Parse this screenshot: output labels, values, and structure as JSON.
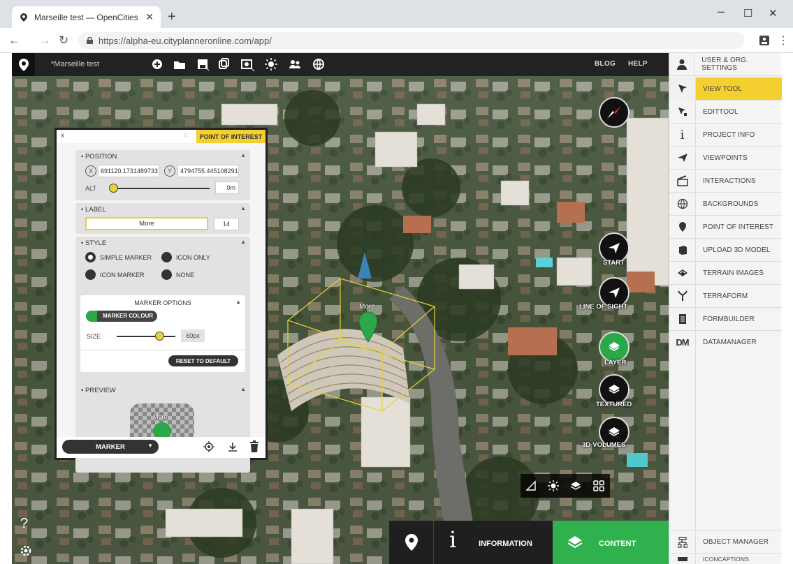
{
  "browser": {
    "tab_title": "Marseille test — OpenCities Plan",
    "url": "https://alpha-eu.cityplanneronline.com/app/"
  },
  "app": {
    "project_name": "*Marseille test",
    "blog": "BLOG",
    "help": "HELP"
  },
  "sidebar": {
    "top_item": "USER & ORG. SETTINGS",
    "items": [
      {
        "label": "VIEW TOOL",
        "icon": "arrow-cursor-icon",
        "active": true
      },
      {
        "label": "EDITTOOL",
        "icon": "edit-cursor-icon"
      },
      {
        "label": "PROJECT INFO",
        "icon": "info-icon"
      },
      {
        "label": "VIEWPOINTS",
        "icon": "paper-plane-icon"
      },
      {
        "label": "INTERACTIONS",
        "icon": "clapperboard-icon"
      },
      {
        "label": "BACKGROUNDS",
        "icon": "globe-icon"
      },
      {
        "label": "POINT OF INTEREST",
        "icon": "map-pin-icon"
      },
      {
        "label": "UPLOAD 3D MODEL",
        "icon": "cube-icon"
      },
      {
        "label": "TERRAIN IMAGES",
        "icon": "terrain-image-icon"
      },
      {
        "label": "TERRAFORM",
        "icon": "terraform-icon"
      },
      {
        "label": "FORMBUILDER",
        "icon": "form-icon"
      },
      {
        "label": "DATAMANAGER",
        "icon": "dm-icon"
      }
    ],
    "object_manager": "OBJECT MANAGER",
    "iconcaptions": "ICONCAPTIONS"
  },
  "poi_panel": {
    "close": "x",
    "title": "POINT OF INTEREST",
    "position": {
      "heading": "• POSITION",
      "x_badge": "X",
      "x_value": "691120.1731489733",
      "y_badge": "Y",
      "y_value": "4794755.445108291",
      "alt_label": "ALT",
      "alt_value": "0m"
    },
    "label": {
      "heading": "• LABEL",
      "text": "More",
      "size": "14"
    },
    "style": {
      "heading": "• STYLE",
      "options": [
        "SIMPLE MARKER",
        "ICON ONLY",
        "ICON MARKER",
        "NONE"
      ],
      "selected": "SIMPLE MARKER"
    },
    "marker_options": {
      "heading": "MARKER OPTIONS",
      "colour_button": "MARKER COLOUR",
      "colour": "#2aa84a",
      "size_label": "SIZE",
      "size_value": "60px",
      "reset": "RESET TO DEFAULT"
    },
    "preview": {
      "heading": "• PREVIEW",
      "label": "More"
    },
    "footer": {
      "dropdown": "MARKER"
    }
  },
  "scene": {
    "marker_label": "More",
    "right_buttons": [
      {
        "label": "START"
      },
      {
        "label": "LINE OF SIGHT"
      },
      {
        "label": "LAYER"
      },
      {
        "label": "TEXTURED"
      },
      {
        "label": "3D-VOLUMES"
      }
    ],
    "question": "?"
  },
  "bottom": {
    "information": "INFORMATION",
    "content": "CONTENT"
  },
  "colors": {
    "accent_yellow": "#f3cf2f",
    "green": "#2aa84a",
    "dark": "#222222"
  }
}
